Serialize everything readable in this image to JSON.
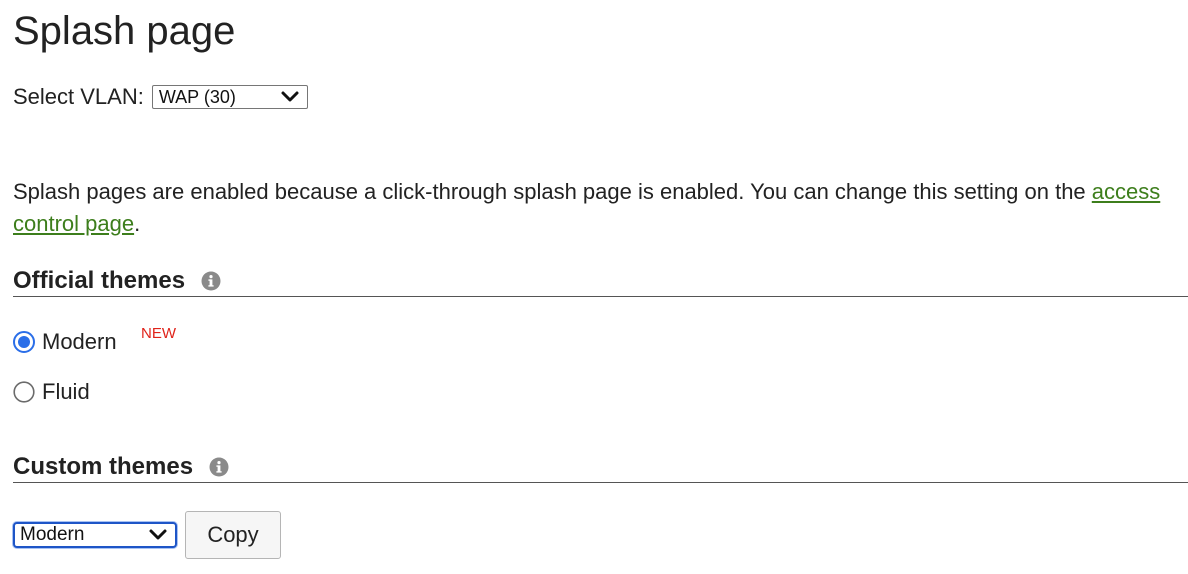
{
  "page": {
    "title": "Splash page"
  },
  "vlan": {
    "label": "Select VLAN:",
    "selected": "WAP (30)"
  },
  "info": {
    "text_before": "Splash pages are enabled because a click-through splash page is enabled. You can change this setting on the ",
    "link_text": "access control page",
    "text_after": "."
  },
  "official_themes": {
    "title": "Official themes",
    "options": [
      {
        "label": "Modern",
        "checked": true,
        "badge": "NEW"
      },
      {
        "label": "Fluid",
        "checked": false
      }
    ]
  },
  "custom_themes": {
    "title": "Custom themes",
    "selected": "Modern",
    "copy_label": "Copy"
  },
  "colors": {
    "link": "#3d7e1c",
    "badge": "#e0231a",
    "radio_accent": "#2a6ee8",
    "focus_border": "#1e55c7"
  },
  "icons": {
    "info": "info-circle-icon",
    "chevron": "chevron-down-icon"
  }
}
